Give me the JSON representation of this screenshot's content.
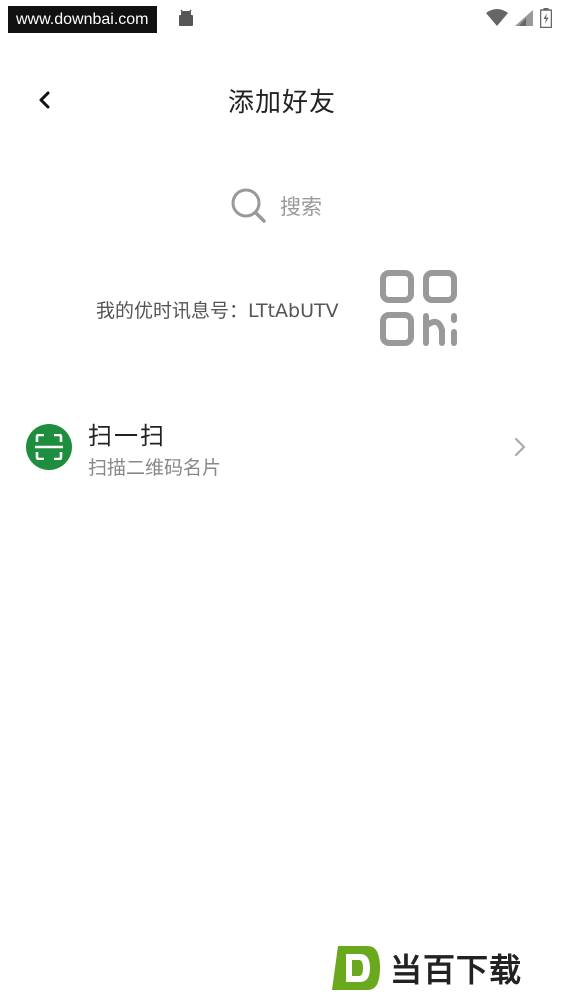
{
  "statusbar": {
    "watermark": "www.downbai.com"
  },
  "header": {
    "title": "添加好友"
  },
  "search": {
    "label": "搜索"
  },
  "my_id": {
    "text": "我的优时讯息号：LTtAbUTV"
  },
  "scan": {
    "title": "扫一扫",
    "subtitle": "扫描二维码名片"
  },
  "watermark_bottom": {
    "text": "当百下载"
  },
  "colors": {
    "accent_green": "#1e8e3e",
    "qr_gray": "#999999",
    "text_primary": "#222222",
    "text_secondary": "#888888"
  }
}
